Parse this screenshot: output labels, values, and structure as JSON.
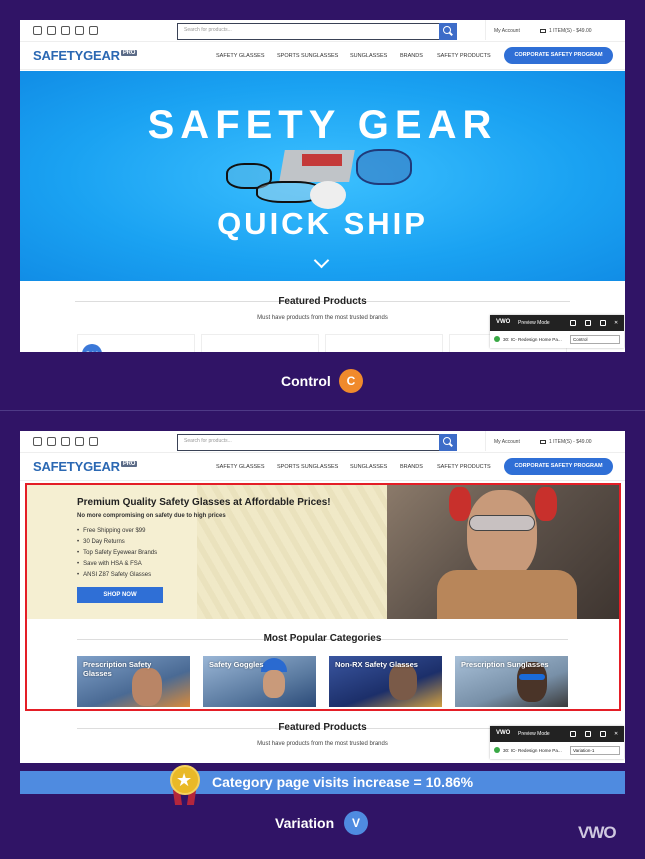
{
  "header": {
    "search_placeholder": "Search for products...",
    "my_account": "My Account",
    "cart": "1 ITEM(S) - $49.00",
    "logo_main": "SAFETYGEAR",
    "logo_sub": "PRO",
    "nav": [
      "SAFETY GLASSES",
      "SPORTS SUNGLASSES",
      "SUNGLASSES",
      "BRANDS",
      "SAFETY PRODUCTS"
    ],
    "cta": "CORPORATE SAFETY PROGRAM",
    "social_icons": [
      "facebook-icon",
      "twitter-icon",
      "instagram-icon",
      "pinterest-icon",
      "youtube-icon"
    ]
  },
  "control": {
    "hero_line1": "SAFETY GEAR",
    "hero_line2": "QUICK SHIP",
    "featured_title": "Featured Products",
    "featured_subtitle": "Must have products from the most trusted brands",
    "sale_badge": "Sale!",
    "label": "Control",
    "badge": "C",
    "badge_color": "#f08a2c"
  },
  "variation": {
    "hero_title": "Premium Quality Safety Glasses at Affordable Prices!",
    "hero_subtitle": "No more compromising on safety due to high prices",
    "bullets": [
      "Free Shipping over $99",
      "30 Day Returns",
      "Top Safety Eyewear Brands",
      "Save with HSA & FSA",
      "ANSI Z87 Safety Glasses"
    ],
    "shop_button": "SHOP NOW",
    "categories_title": "Most Popular Categories",
    "categories": [
      "Prescription Safety Glasses",
      "Safety Goggles",
      "Non-RX Safety Glasses",
      "Prescription Sunglasses"
    ],
    "featured_title": "Featured Products",
    "featured_subtitle": "Must have products from the most trusted brands",
    "label": "Variation",
    "badge": "V",
    "badge_color": "#4f8be0"
  },
  "vwo_bar": {
    "logo": "VWO",
    "mode": "Preview Mode",
    "campaign": "30: IC- Redesign Home Pa...",
    "control_select": "Control",
    "variation_select": "Variation-1"
  },
  "result": {
    "text": "Category page visits increase = 10.86%"
  },
  "footer_logo": "VWO"
}
